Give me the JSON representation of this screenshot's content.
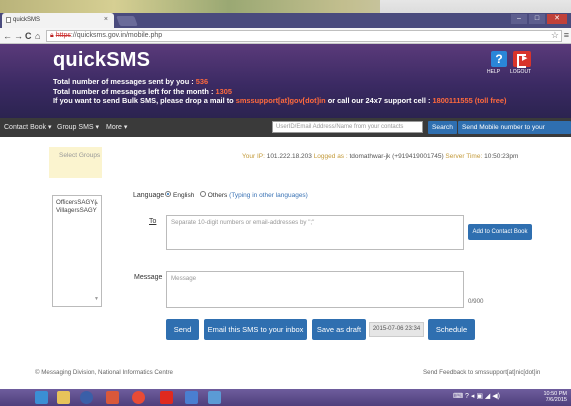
{
  "browser": {
    "tab_title": "quickSMS",
    "tab_close": "×",
    "url_scheme": "https",
    "url_rest": "://quicksms.gov.in/mobile.php",
    "back": "←",
    "forward": "→",
    "reload": "C",
    "home": "⌂",
    "star": "☆",
    "menu": "≡"
  },
  "header": {
    "title": "quickSMS",
    "sent_label": "Total number of messages sent by you : ",
    "sent_count": "536",
    "left_label": "Total number of messages left for the month : ",
    "left_count": "1305",
    "bulk_prefix": "If you want to send Bulk SMS, please drop a mail to ",
    "bulk_email": "smssupport[at]gov[dot]in",
    "bulk_mid": " or call our 24x7 support cell : ",
    "bulk_phone": "1800111555 (toll free)",
    "help_label": "HELP",
    "logout_label": "LOGOUT"
  },
  "nav": {
    "contact_book": "Contact Book ▾",
    "group_sms": "Group SMS ▾",
    "more": "More ▾",
    "search_placeholder": "UserID/Email Address/Name from your contacts",
    "search_btn": "Search",
    "send_mobile_btn": "Send Mobile number to your handset"
  },
  "main": {
    "select_groups": "Select Groups",
    "ip_label": "Your IP: ",
    "ip_value": "101.222.18.203",
    "logged_label": "  Logged as : ",
    "logged_value": "tdomathwar-jk (+919419001745)",
    "time_label": "  Server Time: ",
    "time_value": "10:50:23pm",
    "language_label": "Language",
    "lang_english": "English",
    "lang_others": "Others",
    "lang_typing": "(Typing in other languages)",
    "groups": [
      "OfficersSAGY(",
      "VillagersSAGY"
    ],
    "to_label": "To",
    "to_placeholder": "Separate 10-digit numbers or email-addresses by \";\"",
    "add_contact": "Add to Contact Book",
    "message_label": "Message",
    "message_placeholder": "Message",
    "counter": "0/900",
    "send": "Send",
    "email_sms": "Email this SMS to your inbox",
    "save_draft": "Save as draft",
    "datetime": "2015-07-06 23:34",
    "schedule": "Schedule",
    "footer_left": "© Messaging Division, National Informatics Centre",
    "footer_right": "Send Feedback to smssupport[at]nic[dot]in"
  },
  "taskbar": {
    "time": "10:50 PM",
    "date": "7/6/2015"
  },
  "colors": {
    "header_bg": "#3b2a63",
    "accent_orange": "#ff6a3d",
    "button_blue": "#2f6fb0",
    "navbar_bg": "#3a3a3a"
  }
}
